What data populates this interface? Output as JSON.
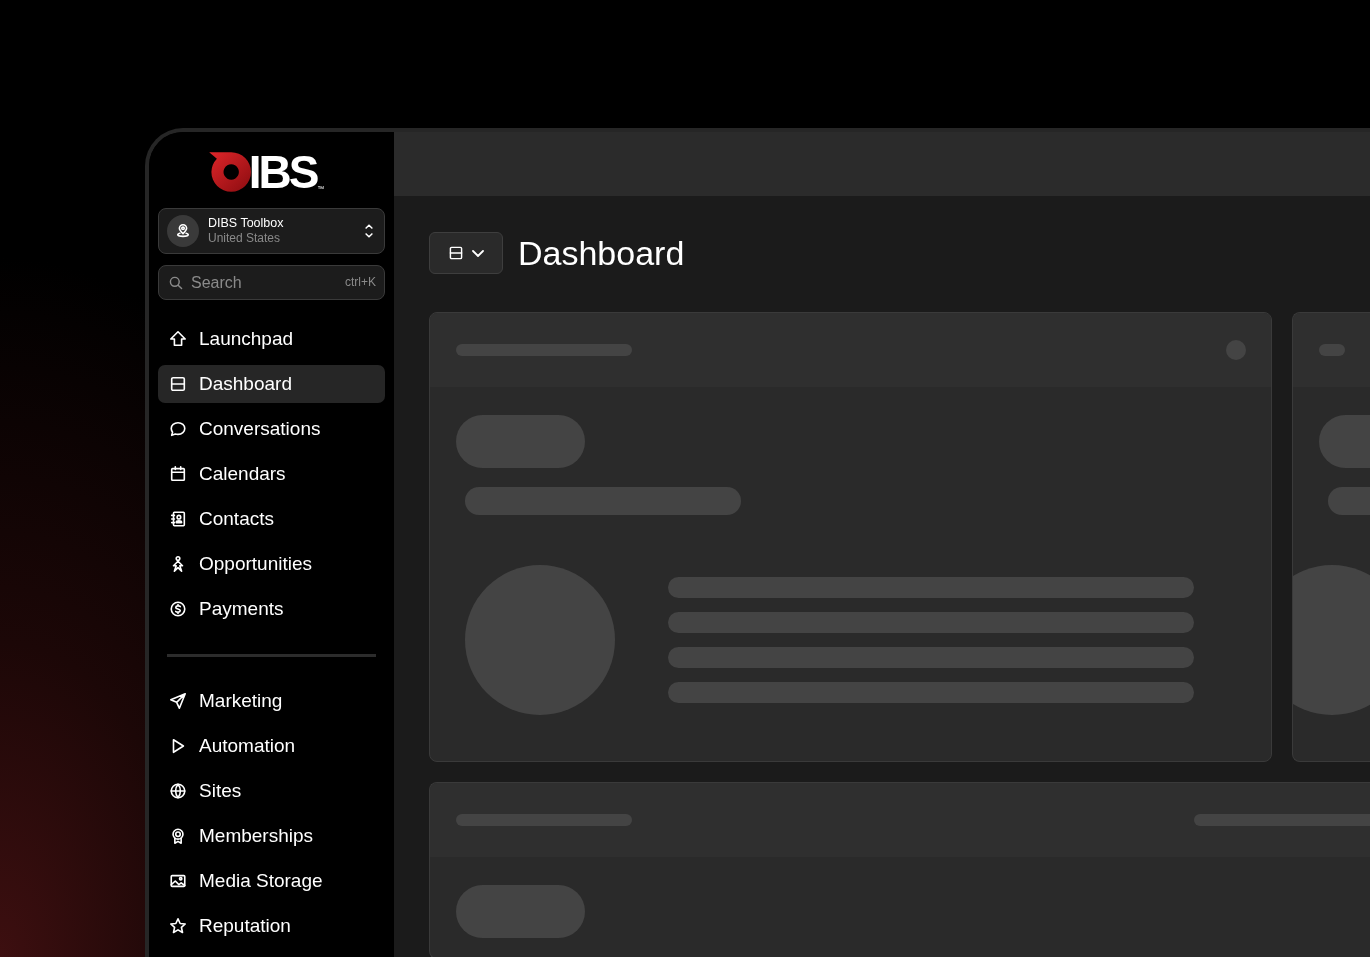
{
  "logo": {
    "wordmark": "IBS",
    "trademark": "™"
  },
  "account": {
    "name": "DIBS Toolbox",
    "location": "United States"
  },
  "search": {
    "placeholder": "Search",
    "shortcut": "ctrl+K"
  },
  "nav_groups": [
    {
      "items": [
        {
          "label": "Launchpad",
          "kind": "launch",
          "selected": false
        },
        {
          "label": "Dashboard",
          "kind": "dashboard",
          "selected": true
        },
        {
          "label": "Conversations",
          "kind": "chat",
          "selected": false
        },
        {
          "label": "Calendars",
          "kind": "calendar",
          "selected": false
        },
        {
          "label": "Contacts",
          "kind": "contacts",
          "selected": false
        },
        {
          "label": "Opportunities",
          "kind": "person",
          "selected": false
        },
        {
          "label": "Payments",
          "kind": "dollar",
          "selected": false
        }
      ]
    },
    {
      "items": [
        {
          "label": "Marketing",
          "kind": "plane",
          "selected": false
        },
        {
          "label": "Automation",
          "kind": "play",
          "selected": false
        },
        {
          "label": "Sites",
          "kind": "globe",
          "selected": false
        },
        {
          "label": "Memberships",
          "kind": "award",
          "selected": false
        },
        {
          "label": "Media Storage",
          "kind": "image",
          "selected": false
        },
        {
          "label": "Reputation",
          "kind": "star",
          "selected": false
        }
      ]
    }
  ],
  "page": {
    "title": "Dashboard"
  },
  "cards": [
    {
      "kind": "summary"
    },
    {
      "kind": "summary_clipped"
    },
    {
      "kind": "list"
    }
  ]
}
